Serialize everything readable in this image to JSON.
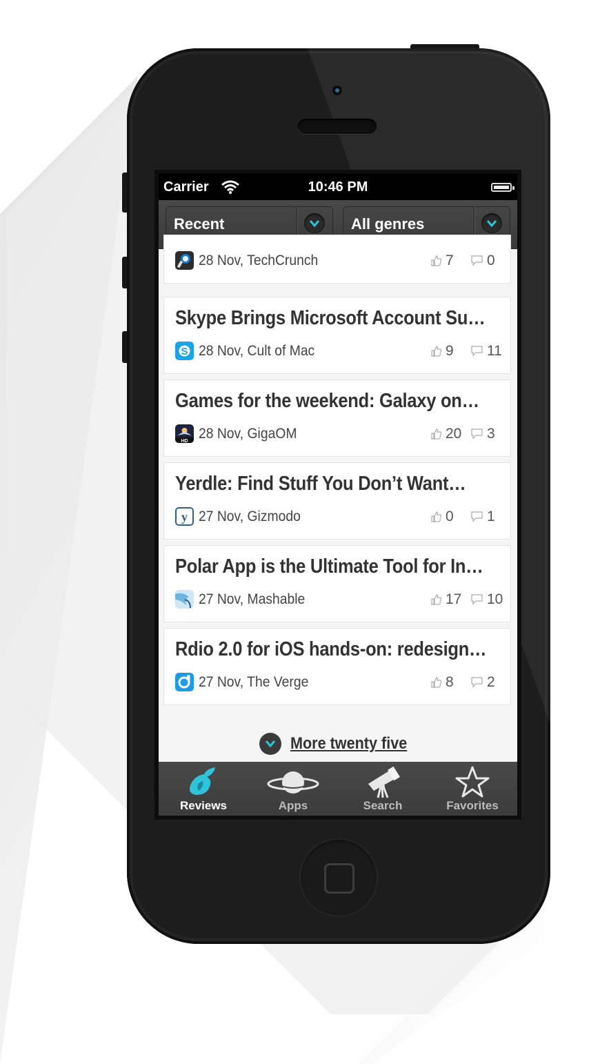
{
  "status_bar": {
    "carrier": "Carrier",
    "time": "10:46 PM"
  },
  "filters": {
    "sort": {
      "selected": "Recent"
    },
    "genre": {
      "selected": "All genres"
    }
  },
  "articles": [
    {
      "title": "",
      "date": "28 Nov, TechCrunch",
      "likes": "7",
      "comments": "0",
      "icon": "techcrunch-icon",
      "icon_color": "#333333"
    },
    {
      "title": "Skype Brings Microsoft Account Su…",
      "date": "28 Nov, Cult of Mac",
      "likes": "9",
      "comments": "11",
      "icon": "skype-icon",
      "icon_color": "#1aa3e8"
    },
    {
      "title": "Games for the weekend: Galaxy on…",
      "date": "28 Nov, GigaOM",
      "likes": "20",
      "comments": "3",
      "icon": "galaxy-game-icon",
      "icon_color": "#1b2340"
    },
    {
      "title": "Yerdle: Find Stuff You Don’t Want…",
      "date": "27 Nov, Gizmodo",
      "likes": "0",
      "comments": "1",
      "icon": "yerdle-icon",
      "icon_color": "#2d5f8a"
    },
    {
      "title": "Polar App is the Ultimate Tool for In…",
      "date": "27 Nov, Mashable",
      "likes": "17",
      "comments": "10",
      "icon": "polar-bird-icon",
      "icon_color": "#6fb4e0"
    },
    {
      "title": "Rdio 2.0 for iOS hands-on: redesign…",
      "date": "27 Nov, The Verge",
      "likes": "8",
      "comments": "2",
      "icon": "rdio-icon",
      "icon_color": "#1e9be6"
    }
  ],
  "more": {
    "label": "More twenty five"
  },
  "tabs": [
    {
      "label": "Reviews",
      "icon": "reviews-drop-icon",
      "active": true
    },
    {
      "label": "Apps",
      "icon": "planet-icon",
      "active": false
    },
    {
      "label": "Search",
      "icon": "telescope-icon",
      "active": false
    },
    {
      "label": "Favorites",
      "icon": "star-icon",
      "active": false
    }
  ],
  "colors": {
    "accent": "#2ec4d9",
    "tabbar": "#424242",
    "card_text": "#333333"
  }
}
